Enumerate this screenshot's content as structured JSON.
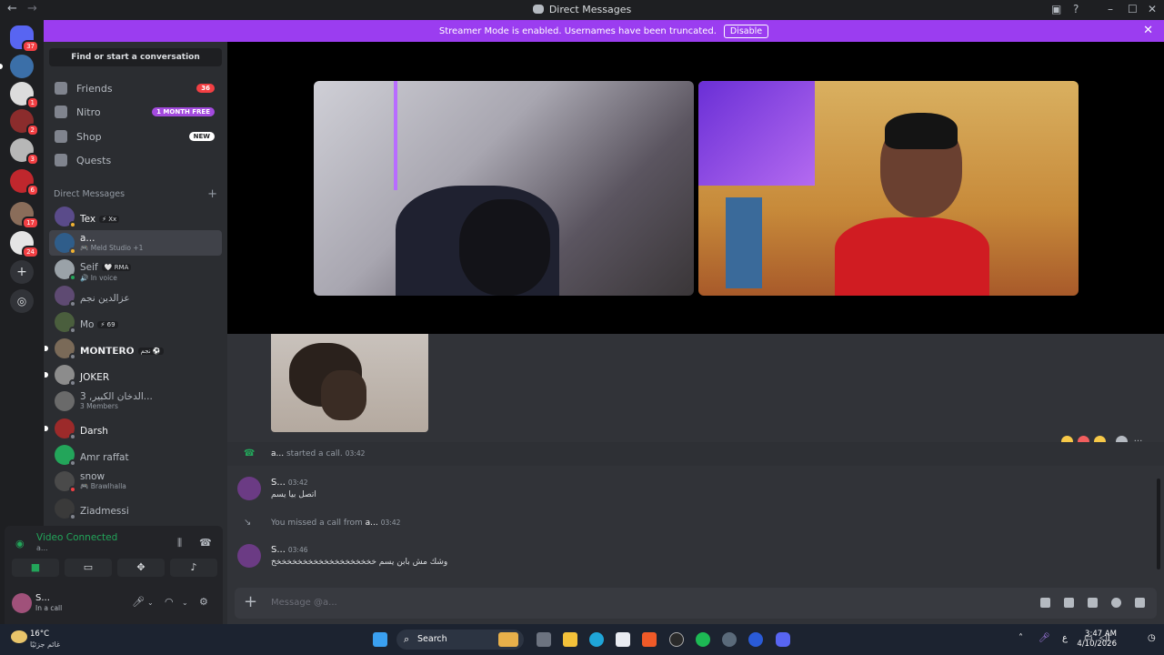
{
  "window": {
    "title": "Direct Messages"
  },
  "banner": {
    "text": "Streamer Mode is enabled. Usernames have been truncated.",
    "button": "Disable"
  },
  "guilds": [
    {
      "badge": "37",
      "color": "#5865f2"
    },
    {
      "badge": "",
      "color": "#3b6fa8"
    },
    {
      "badge": "1",
      "color": "#dcdcdc"
    },
    {
      "badge": "2",
      "color": "#8b2c2c"
    },
    {
      "badge": "3",
      "color": "#b7b7b7"
    },
    {
      "badge": "6",
      "color": "#c0272d"
    },
    {
      "badge": "17",
      "color": "#8a6d5a"
    },
    {
      "badge": "24",
      "color": "#e5e5e5"
    }
  ],
  "sidebar": {
    "find": "Find or start a conversation",
    "nav": [
      {
        "label": "Friends",
        "pill": "36",
        "pill_color": "#f23f43"
      },
      {
        "label": "Nitro",
        "pill": "1 MONTH FREE",
        "pill_color": "#a34ade"
      },
      {
        "label": "Shop",
        "pill": "NEW",
        "pill_color": "#ffffff"
      },
      {
        "label": "Quests",
        "pill": "",
        "pill_color": ""
      }
    ],
    "dm_header": "Direct Messages",
    "dms": [
      {
        "name": "Tex",
        "tag": "⚡ Xx",
        "sub": ""
      },
      {
        "name": "a...",
        "tag": "",
        "sub": "🎮 Meld Studio +1"
      },
      {
        "name": "Seif",
        "tag": "🤍 RMA",
        "sub": "🔊 In voice"
      },
      {
        "name": "عزالدين نجم",
        "tag": "",
        "sub": ""
      },
      {
        "name": "Mo",
        "tag": "⚡ 69",
        "sub": ""
      },
      {
        "name": "𝗠𝗢𝗡𝗧𝗘𝗥𝗢",
        "tag": "نجم ⚽",
        "sub": ""
      },
      {
        "name": "JOKER",
        "tag": "",
        "sub": ""
      },
      {
        "name": "3 ,الدخان الكبير...",
        "tag": "",
        "sub": "3 Members"
      },
      {
        "name": "Darsh",
        "tag": "",
        "sub": ""
      },
      {
        "name": "Amr raffat",
        "tag": "",
        "sub": ""
      },
      {
        "name": "snow",
        "tag": "",
        "sub": "🎮 Brawlhalla"
      },
      {
        "name": "Ziadmessi",
        "tag": "",
        "sub": ""
      }
    ]
  },
  "voice": {
    "status": "Video Connected",
    "channel": "a..."
  },
  "user": {
    "name": "S...",
    "status": "In a call"
  },
  "chat": {
    "call_started": {
      "user": "a...",
      "text": "started a call.",
      "time": "03:42"
    },
    "msg1": {
      "author": "S...",
      "time": "03:42",
      "text": "اتصل بيا يسم"
    },
    "missed": {
      "text": "You missed a call from",
      "user": "a...",
      "time": "03:42"
    },
    "msg2": {
      "author": "S...",
      "time": "03:46",
      "text": "وشك مش بابن يسم خخخخخخخخخخخخخخخخخخخخ"
    },
    "composer_placeholder": "Message @a..."
  },
  "taskbar": {
    "temp": "16°C",
    "weather": "غائم جزئيًا",
    "search": "Search",
    "lang": "ع",
    "time": "3:47 AM",
    "date": "4/10/2026"
  }
}
